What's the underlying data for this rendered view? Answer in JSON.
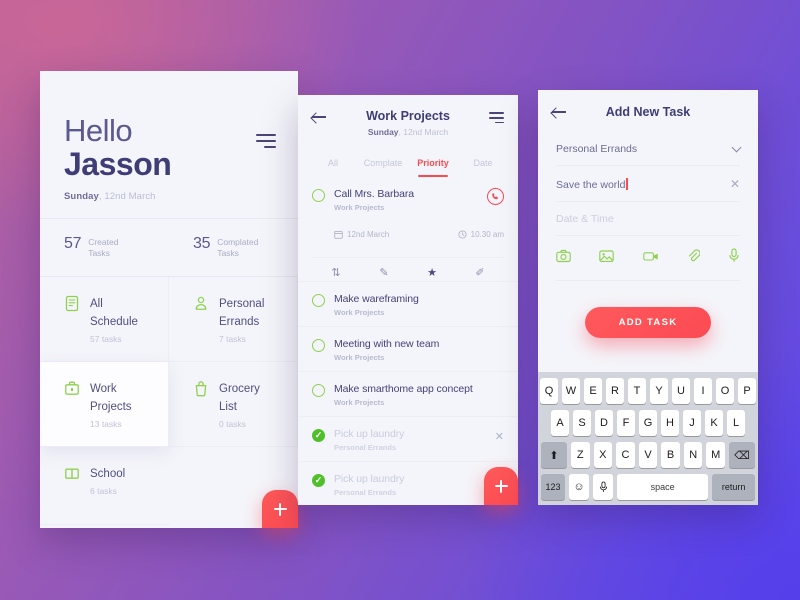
{
  "background": {
    "from": "#b5619b",
    "to": "#5a46e8"
  },
  "accent": {
    "red": "#fb4a52",
    "green": "#8fd14f",
    "purple": "#3f3d75"
  },
  "screen1": {
    "menu_icon": "hamburger-icon",
    "greeting": "Hello",
    "user_name": "Jasson",
    "date_day": "Sunday",
    "date_rest": ", 12nd March",
    "stats": [
      {
        "number": "57",
        "label": "Created\nTasks",
        "label_line1": "Created",
        "label_line2": "Tasks"
      },
      {
        "number": "35",
        "label": "Complated\nTasks",
        "label_line1": "Complated",
        "label_line2": "Tasks"
      }
    ],
    "categories": [
      {
        "name_line1": "All",
        "name_line2": "Schedule",
        "count": "57 tasks",
        "icon": "list-document-icon",
        "selected": false
      },
      {
        "name_line1": "Personal",
        "name_line2": "Errands",
        "count": "7 tasks",
        "icon": "person-icon",
        "selected": false
      },
      {
        "name_line1": "Work",
        "name_line2": "Projects",
        "count": "13 tasks",
        "icon": "briefcase-icon",
        "selected": true
      },
      {
        "name_line1": "Grocery",
        "name_line2": "List",
        "count": "0 tasks",
        "icon": "shopping-bag-icon",
        "selected": false
      },
      {
        "name_line1": "School",
        "name_line2": "",
        "count": "6 tasks",
        "icon": "book-icon",
        "selected": false
      }
    ],
    "fab": "add-task-fab"
  },
  "screen2": {
    "back_icon": "back-arrow-icon",
    "title": "Work Projects",
    "date_day": "Sunday",
    "date_rest": ", 12nd March",
    "menu_icon": "hamburger-icon",
    "tabs": [
      {
        "label": "All",
        "active": false
      },
      {
        "label": "Complate",
        "active": false
      },
      {
        "label": "Priority",
        "active": true
      },
      {
        "label": "Date",
        "active": false
      }
    ],
    "featured_task": {
      "name": "Call Mrs. Barbara",
      "category": "Work Projects",
      "date": "12nd March",
      "time": "10.30 am",
      "call_icon": "phone-icon",
      "actions": [
        "transfer-icon",
        "edit-pencil-icon",
        "star-icon",
        "pencil-note-icon"
      ]
    },
    "tasks": [
      {
        "name": "Make wareframing",
        "category": "Work Projects",
        "done": false
      },
      {
        "name": "Meeting with new team",
        "category": "Work Projects",
        "done": false
      },
      {
        "name": "Make smarthome app concept",
        "category": "Work Projects",
        "done": false
      },
      {
        "name": "Pick up laundry",
        "category": "Personal Errands",
        "done": true
      },
      {
        "name": "Pick up laundry",
        "category": "Personal Errands",
        "done": true
      }
    ],
    "fab": "add-task-fab"
  },
  "screen3": {
    "back_icon": "back-arrow-icon",
    "title": "Add New Task",
    "category_value": "Personal Errands",
    "task_value": "Save the world",
    "datetime_placeholder": "Date & Time",
    "media_icons": [
      "camera-icon",
      "photo-icon",
      "video-icon",
      "attachment-icon",
      "microphone-icon"
    ],
    "add_button": "ADD TASK",
    "keyboard": {
      "row1": [
        "Q",
        "W",
        "E",
        "R",
        "T",
        "Y",
        "U",
        "I",
        "O",
        "P"
      ],
      "row2": [
        "A",
        "S",
        "D",
        "F",
        "G",
        "H",
        "J",
        "K",
        "L"
      ],
      "row3": [
        "Z",
        "X",
        "C",
        "V",
        "B",
        "N",
        "M"
      ],
      "shift": "⬆",
      "backspace": "⌫",
      "numbers": "123",
      "emoji": "☺",
      "mic": "mic-icon",
      "space": "space",
      "return": "return"
    }
  }
}
